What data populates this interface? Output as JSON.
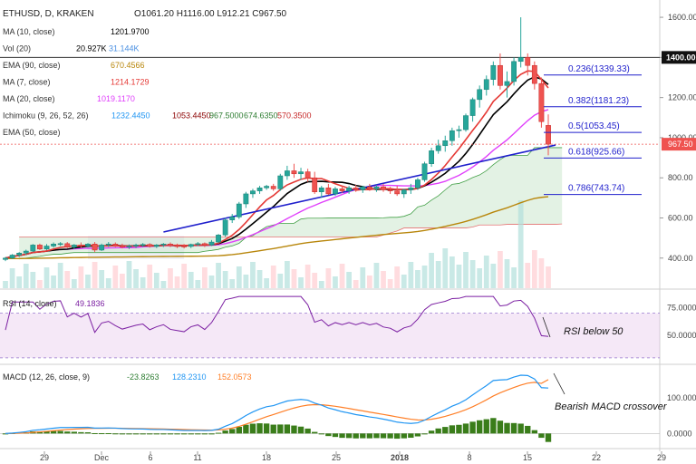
{
  "header": {
    "symbol": "ETHUSD, D, KRAKEN",
    "ohlc": "O1061.20  H1116.00  L912.21  C967.50"
  },
  "indicators": [
    {
      "label": "MA (10, close)",
      "values": [
        "1201.9700"
      ],
      "colors": [
        "#000000"
      ]
    },
    {
      "label": "Vol (20)",
      "values": [
        "20.927K",
        "31.144K"
      ],
      "colors": [
        "#000000",
        "#4a90e2"
      ]
    },
    {
      "label": "EMA (90, close)",
      "values": [
        "670.4566"
      ],
      "colors": [
        "#b8860b"
      ]
    },
    {
      "label": "MA (7, close)",
      "values": [
        "1214.1729"
      ],
      "colors": [
        "#e53935"
      ]
    },
    {
      "label": "MA (20, close)",
      "values": [
        "1019.1170"
      ],
      "colors": [
        "#e040fb"
      ]
    },
    {
      "label": "Ichimoku (9, 26, 52, 26)",
      "values": [
        "1232.4450",
        "1053.4450",
        "967.5000",
        "674.6350",
        "570.3500"
      ],
      "colors": [
        "#2196f3",
        "#8b0000",
        "#2e7d32",
        "#2e7d32",
        "#c62828"
      ]
    },
    {
      "label": "EMA (50, close)",
      "values": [],
      "colors": []
    }
  ],
  "price_axis": {
    "ticks": [
      "1600.00",
      "1400.00",
      "1200.00",
      "1000.00",
      "800.00",
      "600.00",
      "400.00"
    ],
    "last_price": "967.50",
    "level_1400": "1400.00"
  },
  "fib": [
    "0.236(1339.33)",
    "0.382(1181.23)",
    "0.5(1053.45)",
    "0.618(925.66)",
    "0.786(743.74)"
  ],
  "rsi": {
    "label": "RSI (14, close)",
    "value": "49.1836",
    "ticks": [
      "75.0000",
      "50.0000"
    ],
    "annotation": "RSI below 50"
  },
  "macd": {
    "label": "MACD (12, 26, close, 9)",
    "values": [
      "-23.8263",
      "128.2310",
      "152.0573"
    ],
    "ticks": [
      "100.0000",
      "0.0000"
    ],
    "annotation": "Bearish MACD crossover"
  },
  "x_axis": {
    "ticks": [
      "29",
      "Dec",
      "6",
      "11",
      "18",
      "25",
      "2018",
      "8",
      "15",
      "22",
      "29"
    ]
  },
  "colors": {
    "up": "#26a69a",
    "down": "#ef5350",
    "ma7": "#e53935",
    "ma10": "#000000",
    "ma20": "#e040fb",
    "ema90": "#b8860b",
    "trend": "#1f1fcc",
    "rsi": "#7b1fa2",
    "macd": "#2196f3",
    "signal": "#ff7f27",
    "hist": "#3a7d1a"
  },
  "chart_data": {
    "type": "candlestick",
    "title": "ETHUSD, D, KRAKEN",
    "candles": [
      [
        393,
        405,
        385,
        400
      ],
      [
        400,
        420,
        395,
        415
      ],
      [
        415,
        430,
        405,
        425
      ],
      [
        425,
        442,
        415,
        435
      ],
      [
        435,
        470,
        430,
        465
      ],
      [
        465,
        472,
        440,
        445
      ],
      [
        445,
        470,
        440,
        460
      ],
      [
        460,
        478,
        452,
        470
      ],
      [
        470,
        480,
        460,
        472
      ],
      [
        472,
        480,
        450,
        455
      ],
      [
        455,
        470,
        445,
        465
      ],
      [
        465,
        478,
        450,
        460
      ],
      [
        460,
        475,
        452,
        470
      ],
      [
        470,
        480,
        430,
        440
      ],
      [
        440,
        472,
        435,
        465
      ],
      [
        465,
        480,
        455,
        470
      ],
      [
        470,
        478,
        455,
        462
      ],
      [
        462,
        472,
        448,
        455
      ],
      [
        455,
        468,
        445,
        460
      ],
      [
        460,
        472,
        450,
        465
      ],
      [
        465,
        475,
        455,
        468
      ],
      [
        468,
        474,
        452,
        458
      ],
      [
        458,
        470,
        450,
        465
      ],
      [
        465,
        475,
        455,
        470
      ],
      [
        470,
        478,
        455,
        462
      ],
      [
        462,
        472,
        450,
        460
      ],
      [
        460,
        470,
        448,
        458
      ],
      [
        458,
        472,
        450,
        468
      ],
      [
        468,
        480,
        460,
        472
      ],
      [
        472,
        478,
        455,
        465
      ],
      [
        465,
        490,
        460,
        480
      ],
      [
        480,
        520,
        475,
        515
      ],
      [
        515,
        600,
        505,
        590
      ],
      [
        590,
        620,
        575,
        605
      ],
      [
        605,
        680,
        595,
        670
      ],
      [
        670,
        730,
        650,
        720
      ],
      [
        720,
        745,
        700,
        735
      ],
      [
        735,
        760,
        720,
        750
      ],
      [
        750,
        765,
        740,
        758
      ],
      [
        758,
        770,
        735,
        745
      ],
      [
        745,
        820,
        735,
        810
      ],
      [
        810,
        860,
        790,
        835
      ],
      [
        835,
        870,
        800,
        820
      ],
      [
        820,
        850,
        790,
        830
      ],
      [
        830,
        845,
        780,
        800
      ],
      [
        800,
        830,
        720,
        730
      ],
      [
        730,
        760,
        700,
        750
      ],
      [
        750,
        770,
        715,
        720
      ],
      [
        720,
        755,
        710,
        745
      ],
      [
        745,
        760,
        725,
        735
      ],
      [
        735,
        760,
        720,
        750
      ],
      [
        750,
        765,
        730,
        740
      ],
      [
        740,
        760,
        725,
        755
      ],
      [
        755,
        770,
        735,
        745
      ],
      [
        745,
        765,
        730,
        755
      ],
      [
        755,
        770,
        730,
        740
      ],
      [
        740,
        755,
        720,
        735
      ],
      [
        735,
        760,
        710,
        720
      ],
      [
        720,
        745,
        700,
        740
      ],
      [
        740,
        770,
        720,
        750
      ],
      [
        750,
        800,
        740,
        790
      ],
      [
        790,
        880,
        780,
        870
      ],
      [
        870,
        950,
        855,
        935
      ],
      [
        935,
        990,
        920,
        960
      ],
      [
        960,
        1010,
        930,
        985
      ],
      [
        985,
        1050,
        960,
        1035
      ],
      [
        1035,
        1060,
        1000,
        1040
      ],
      [
        1040,
        1120,
        1030,
        1110
      ],
      [
        1110,
        1200,
        1080,
        1190
      ],
      [
        1190,
        1260,
        1150,
        1240
      ],
      [
        1240,
        1310,
        1210,
        1290
      ],
      [
        1290,
        1380,
        1260,
        1360
      ],
      [
        1360,
        1420,
        1240,
        1260
      ],
      [
        1260,
        1330,
        1200,
        1280
      ],
      [
        1280,
        1400,
        1260,
        1380
      ],
      [
        1380,
        1600,
        1350,
        1400
      ],
      [
        1400,
        1420,
        1310,
        1360
      ],
      [
        1360,
        1380,
        1240,
        1270
      ],
      [
        1270,
        1300,
        1050,
        1080
      ],
      [
        1061.2,
        1116,
        912.21,
        967.5
      ]
    ],
    "fib_levels": [
      {
        "ratio": "0.236",
        "price": 1339.33
      },
      {
        "ratio": "0.382",
        "price": 1181.23
      },
      {
        "ratio": "0.5",
        "price": 1053.45
      },
      {
        "ratio": "0.618",
        "price": 925.66
      },
      {
        "ratio": "0.786",
        "price": 743.74
      }
    ],
    "trendline": {
      "from": [
        23,
        530
      ],
      "to": [
        33,
        900
      ]
    },
    "horizontal_levels": [
      1400
    ],
    "ylim": [
      250,
      1650
    ],
    "rsi_ylim": [
      25,
      90
    ],
    "rsi_levels": [
      70,
      30
    ],
    "rsi_last": 49.1836,
    "macd_ylim": [
      -40,
      190
    ],
    "macd_last": {
      "macd": 128.231,
      "signal": 152.0573,
      "histogram": -23.8263
    }
  }
}
